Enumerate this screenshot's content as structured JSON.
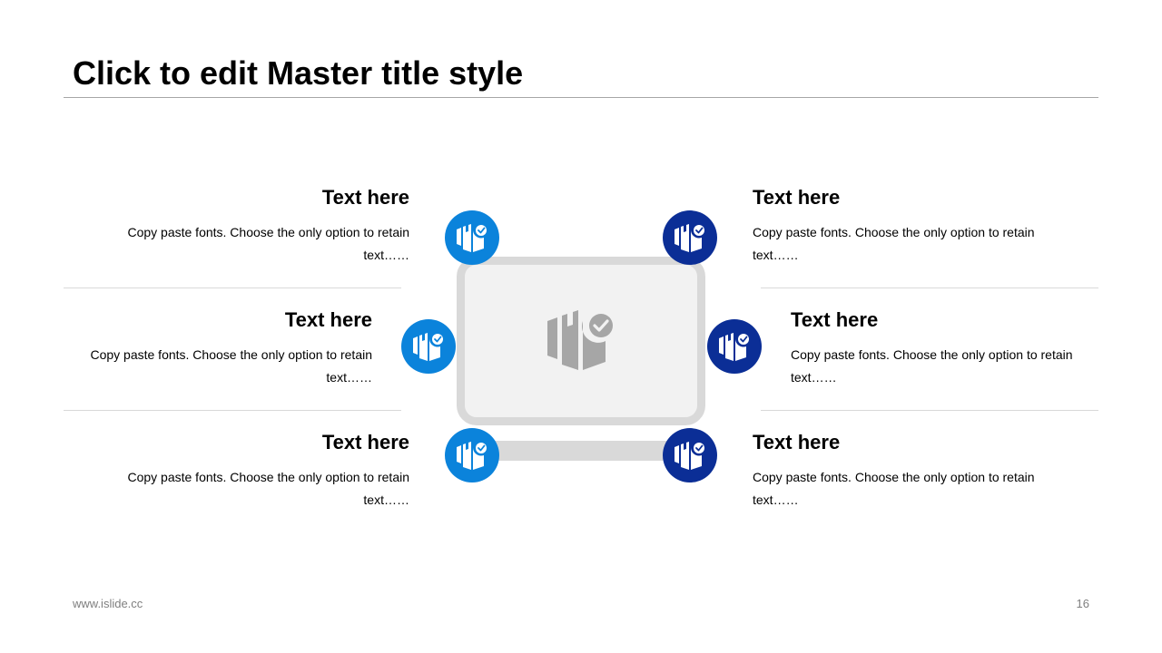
{
  "slide": {
    "title": "Click to edit Master title style",
    "footer_url": "www.islide.cc",
    "page_number": "16"
  },
  "colors": {
    "light_blue": "#0b83db",
    "dark_blue": "#0b2e96",
    "box_fill": "#f2f2f2",
    "box_border": "#d9d9d9",
    "center_icon": "#a6a6a6"
  },
  "items": [
    {
      "heading": "Text here",
      "body": "Copy paste fonts. Choose the only option to retain text……",
      "icon": "package-check-icon"
    },
    {
      "heading": "Text here",
      "body": "Copy paste fonts. Choose the only option to retain text……",
      "icon": "package-check-icon"
    },
    {
      "heading": "Text here",
      "body": "Copy paste fonts. Choose the only option to retain text……",
      "icon": "package-check-icon"
    },
    {
      "heading": "Text here",
      "body": "Copy paste fonts. Choose the only option to retain text……",
      "icon": "package-check-icon"
    },
    {
      "heading": "Text here",
      "body": "Copy paste fonts. Choose the only option to retain text……",
      "icon": "package-check-icon"
    },
    {
      "heading": "Text here",
      "body": "Copy paste fonts. Choose the only option to retain text……",
      "icon": "package-check-icon"
    }
  ]
}
